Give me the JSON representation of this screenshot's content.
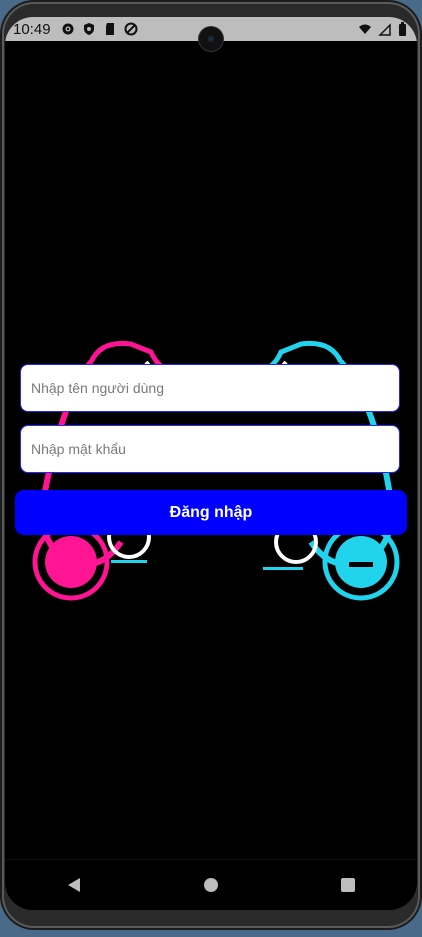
{
  "status_bar": {
    "time": "10:49",
    "left_icons": [
      "gear-icon",
      "shield-icon",
      "sd-card-icon",
      "do-not-disturb-icon"
    ],
    "right_icons": [
      "wifi-icon",
      "cellular-signal-icon",
      "battery-icon"
    ]
  },
  "login": {
    "username_placeholder": "Nhập tên người dùng",
    "password_placeholder": "Nhập mật khẩu",
    "submit_label": "Đăng nhập"
  },
  "colors": {
    "accent": "#0000ff",
    "art_pink": "#ff1493",
    "art_cyan": "#22d3ee"
  },
  "navigation": {
    "buttons": [
      "back-icon",
      "home-icon",
      "recents-icon"
    ]
  }
}
